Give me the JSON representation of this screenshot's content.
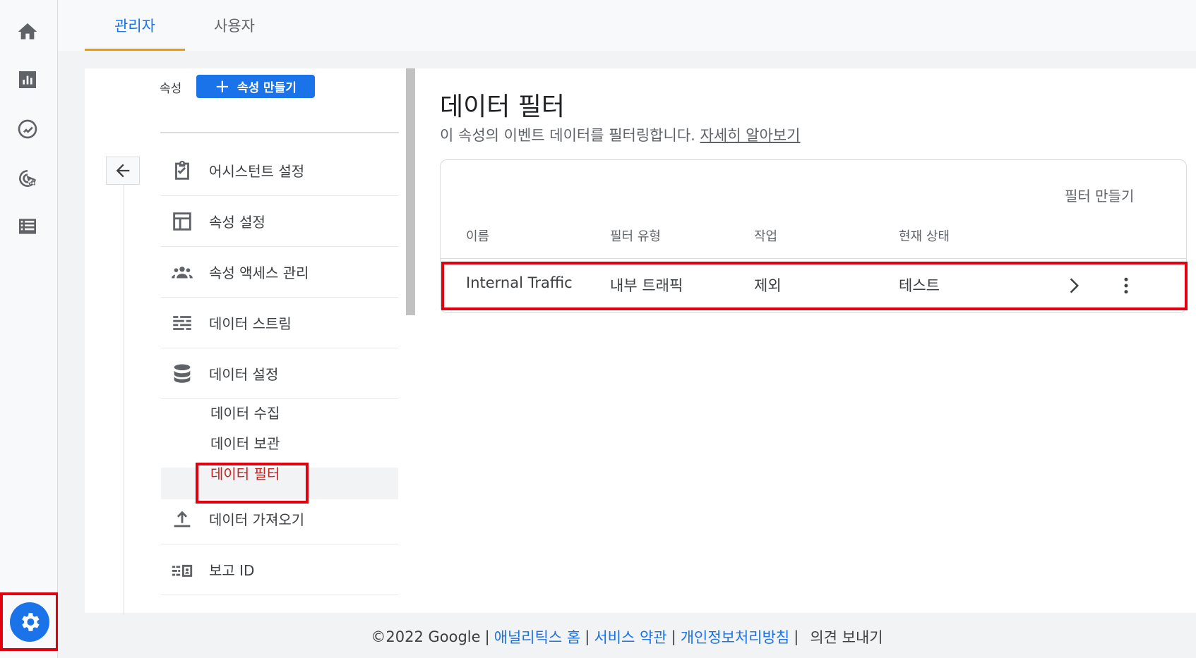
{
  "tabs": {
    "admin": "관리자",
    "user": "사용자"
  },
  "rail": {
    "icons": [
      "home-icon",
      "reports-icon",
      "explore-icon",
      "advertising-icon",
      "configure-icon"
    ],
    "settings_icon": "gear-icon"
  },
  "property": {
    "label": "속성",
    "create_button": "속성 만들기"
  },
  "menu": {
    "items": [
      {
        "label": "어시스턴트 설정",
        "icon": "checklist-icon"
      },
      {
        "label": "속성 설정",
        "icon": "layout-icon"
      },
      {
        "label": "속성 액세스 관리",
        "icon": "people-icon"
      },
      {
        "label": "데이터 스트림",
        "icon": "streams-icon"
      },
      {
        "label": "데이터 설정",
        "icon": "database-icon"
      }
    ],
    "sub_items": [
      "데이터 수집",
      "데이터 보관",
      "데이터 필터"
    ],
    "bottom_items": [
      {
        "label": "데이터 가져오기",
        "icon": "upload-icon"
      },
      {
        "label": "보고 ID",
        "icon": "report-id-icon"
      }
    ]
  },
  "main": {
    "title": "데이터 필터",
    "description": "이 속성의 이벤트 데이터를 필터링합니다.",
    "learn_more": "자세히 알아보기",
    "create_filter": "필터 만들기",
    "columns": [
      "이름",
      "필터 유형",
      "작업",
      "현재 상태"
    ],
    "rows": [
      {
        "name": "Internal Traffic",
        "type": "내부 트래픽",
        "action": "제외",
        "state": "테스트"
      }
    ]
  },
  "footer": {
    "copyright": "©2022 Google",
    "links": [
      "애널리틱스 홈",
      "서비스 약관",
      "개인정보처리방침"
    ],
    "feedback": "의견 보내기"
  },
  "colors": {
    "accent": "#1a73e8",
    "tab_indicator": "#f29900",
    "highlight_box": "#e2000f",
    "active_sub_item": "#c5221f"
  }
}
